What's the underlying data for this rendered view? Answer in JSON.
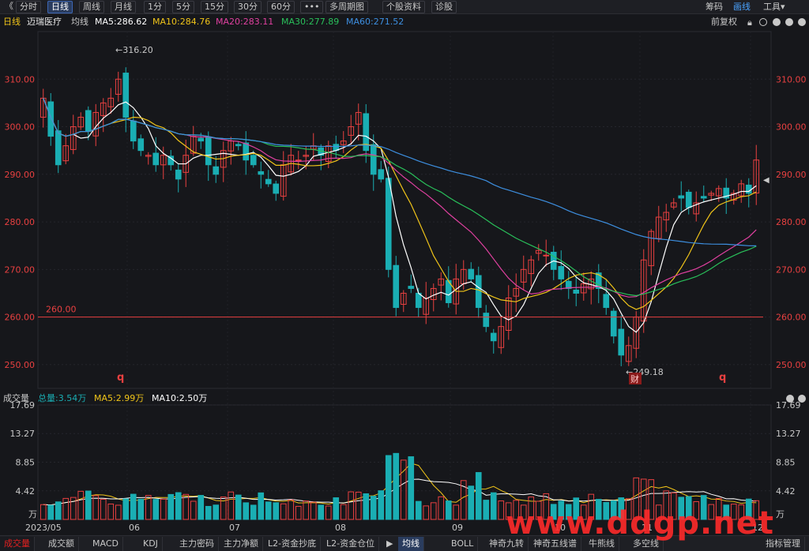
{
  "toolbar": {
    "collapse_icon": "double-chevron-left-icon",
    "collapse_glyph": "《",
    "periods": [
      "分时",
      "日线",
      "周线",
      "月线",
      "1分",
      "5分",
      "15分",
      "30分",
      "60分",
      "•••",
      "多周期图",
      "个股资料",
      "诊股"
    ],
    "active_period": "日线",
    "right_items": [
      "筹码",
      "画线",
      "工具▾"
    ],
    "active_right": "画线"
  },
  "chart_header": {
    "period": "日线",
    "stock_name": "迈瑞医疗",
    "ma_label": "均线",
    "ma5": "MA5:286.62",
    "ma10": "MA10:284.76",
    "ma20": "MA20:283.11",
    "ma30": "MA30:277.89",
    "ma60": "MA60:271.52",
    "adjust": "前复权",
    "colors": {
      "ma5": "#ffffff",
      "ma10": "#f0c419",
      "ma20": "#e040a0",
      "ma30": "#29c05a",
      "ma60": "#3d8fe0",
      "up": "#e84040",
      "down": "#1aaeb3"
    }
  },
  "price_axis": {
    "labels": [
      "310.00",
      "300.00",
      "290.00",
      "280.00",
      "270.00",
      "260.00",
      "250.00"
    ],
    "values": [
      310,
      300,
      290,
      280,
      270,
      260,
      250
    ]
  },
  "annotations": {
    "high": "316.20",
    "low": "249.18",
    "hline": "260.00",
    "marker_q": "q",
    "marker_cai": "财"
  },
  "volume_header": {
    "title": "成交量",
    "total": "总量:3.54万",
    "ma5": "MA5:2.99万",
    "ma10": "MA10:2.50万"
  },
  "volume_axis": {
    "labels": [
      "17.69",
      "13.27",
      "8.85",
      "4.42",
      "万"
    ],
    "values": [
      17.69,
      13.27,
      8.85,
      4.42
    ]
  },
  "date_axis": [
    "2023/05",
    "06",
    "07",
    "08",
    "09",
    "10",
    "11",
    "12"
  ],
  "bottom_tabs": [
    "成交量",
    "成交额",
    "MACD",
    "KDJ",
    "主力密码",
    "主力净额",
    "L2-资金抄底",
    "L2-资金仓位"
  ],
  "active_bottom": "成交量",
  "indicator_tabs": [
    "均线",
    "BOLL",
    "神奇九转",
    "神奇五线谱",
    "牛熊线",
    "多空线",
    "指标管理"
  ],
  "active_indicator": "均线",
  "watermark": "www.ddgp.net",
  "chart_data": {
    "type": "candlestick",
    "closes": [
      306,
      298,
      292,
      296,
      300,
      302,
      299,
      303,
      305,
      306,
      310,
      302,
      297,
      295,
      294,
      292,
      294,
      292,
      289,
      294,
      298,
      297,
      292,
      290,
      295,
      297,
      296,
      293,
      292,
      290,
      288,
      286,
      292,
      294,
      293,
      294,
      296,
      294,
      296,
      295,
      297,
      300,
      303,
      295,
      290,
      289,
      270,
      262,
      265,
      266,
      262,
      264,
      266,
      268,
      263,
      268,
      270,
      268,
      262,
      258,
      255,
      258,
      264,
      266,
      270,
      272,
      274,
      273,
      270,
      268,
      266,
      265,
      267,
      268,
      266,
      262,
      256,
      252,
      254,
      260,
      272,
      278,
      281,
      282,
      284,
      285,
      283,
      284,
      285,
      286,
      287,
      285,
      286,
      288,
      286,
      293
    ],
    "ylim": [
      245,
      320
    ],
    "volume_ylim": [
      0,
      17.69
    ]
  }
}
